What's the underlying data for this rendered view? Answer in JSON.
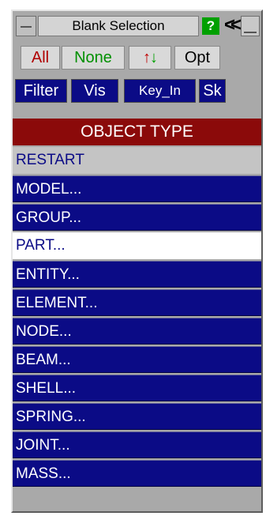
{
  "window": {
    "title": "Blank Selection",
    "help_label": "?",
    "back_label": "<<"
  },
  "toolbar": {
    "all_label": "All",
    "none_label": "None",
    "sort_up": "↑",
    "sort_down": "↓",
    "opt_label": "Opt",
    "filter_label": "Filter",
    "vis_label": "Vis",
    "keyin_label": "Key_In",
    "sk_label": "Sk"
  },
  "list": {
    "header": "OBJECT TYPE",
    "items": [
      {
        "label": "RESTART",
        "state": "gray"
      },
      {
        "label": "MODEL...",
        "state": "dark"
      },
      {
        "label": "GROUP...",
        "state": "dark"
      },
      {
        "label": "PART...",
        "state": "selected"
      },
      {
        "label": "ENTITY...",
        "state": "dark"
      },
      {
        "label": "ELEMENT...",
        "state": "dark"
      },
      {
        "label": "NODE...",
        "state": "dark"
      },
      {
        "label": "BEAM...",
        "state": "dark"
      },
      {
        "label": "SHELL...",
        "state": "dark"
      },
      {
        "label": "SPRING...",
        "state": "dark"
      },
      {
        "label": "JOINT...",
        "state": "dark"
      },
      {
        "label": "MASS...",
        "state": "dark"
      }
    ]
  },
  "colors": {
    "panel_bg": "#a9a9a9",
    "header_red": "#8b0a0a",
    "item_blue": "#0b0b86",
    "selected_bg": "#ffffff",
    "help_green": "#00a000"
  }
}
